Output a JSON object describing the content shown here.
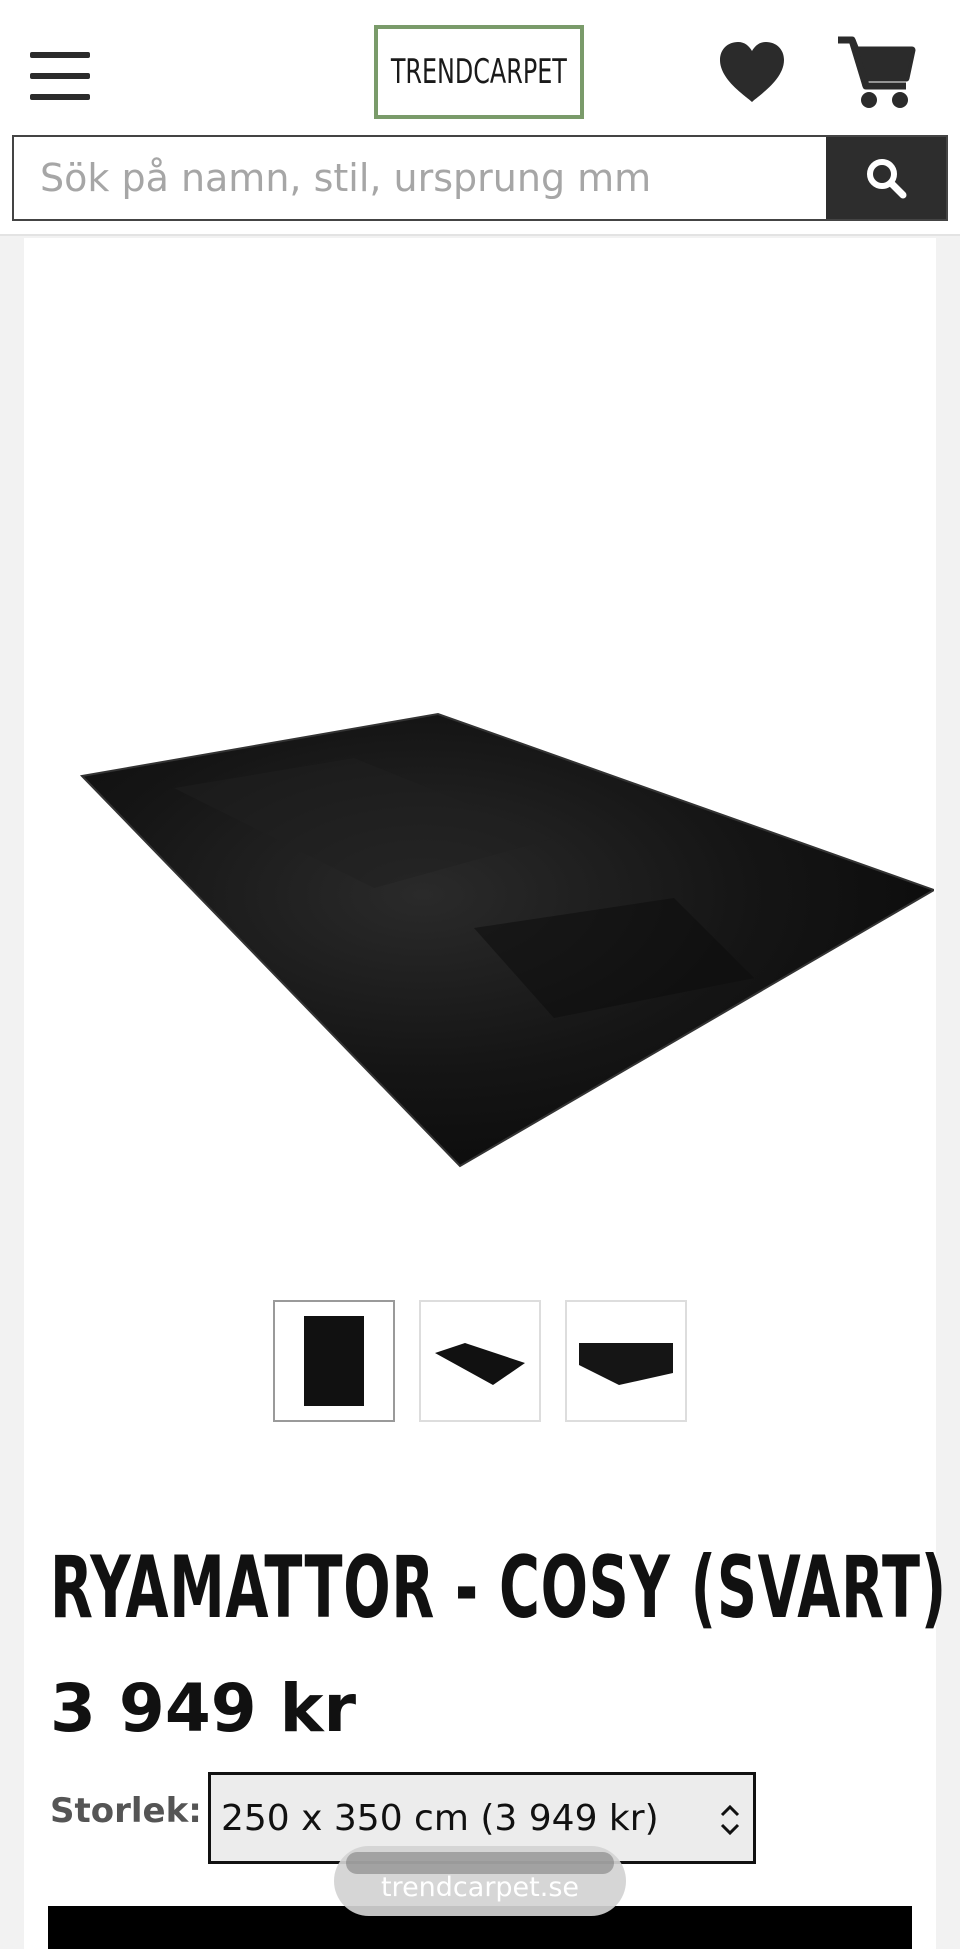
{
  "header": {
    "logo_text": "TRENDCARPET",
    "icons": [
      "hamburger-menu-icon",
      "heart-icon",
      "shopping-cart-icon"
    ],
    "accent_color": "#7a9b6a"
  },
  "search": {
    "placeholder": "Sök på namn, stil, ursprung mm",
    "button_icon": "search-icon"
  },
  "product": {
    "title": "RYAMATTOR - COSY (SVART)",
    "price": "3 949 kr",
    "size_label": "Storlek:",
    "size_selected": "250 x 350 cm (3 949 kr)",
    "thumbnails": [
      "rug-top-view",
      "rug-angled-view",
      "rug-side-view"
    ],
    "active_thumbnail": 0
  },
  "browser": {
    "url": "trendcarpet.se"
  }
}
